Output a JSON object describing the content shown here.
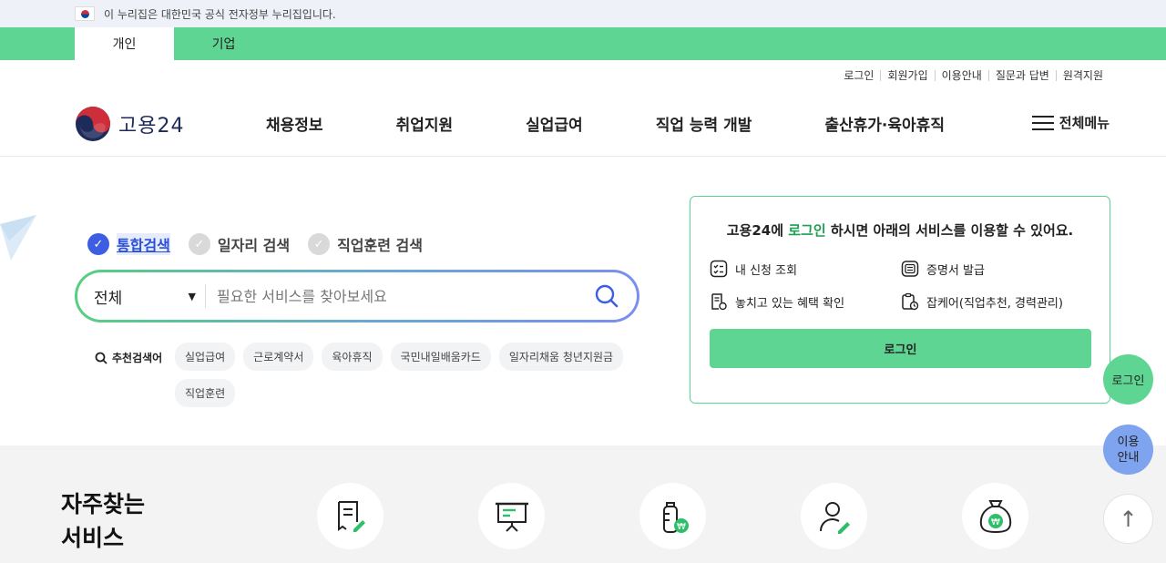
{
  "gov_banner": {
    "text": "이 누리집은 대한민국 공식 전자정부 누리집입니다."
  },
  "audience_tabs": [
    {
      "label": "개인"
    },
    {
      "label": "기업"
    }
  ],
  "util_links": [
    {
      "label": "로그인"
    },
    {
      "label": "회원가입"
    },
    {
      "label": "이용안내"
    },
    {
      "label": "질문과 답변"
    },
    {
      "label": "원격지원"
    }
  ],
  "header": {
    "logo_text": "고용24",
    "menu": [
      {
        "label": "채용정보"
      },
      {
        "label": "취업지원"
      },
      {
        "label": "실업급여"
      },
      {
        "label": "직업 능력 개발"
      },
      {
        "label": "출산휴가·육아휴직"
      }
    ],
    "all_menu": "전체메뉴"
  },
  "search": {
    "tabs": [
      {
        "label": "통합검색"
      },
      {
        "label": "일자리 검색"
      },
      {
        "label": "직업훈련 검색"
      }
    ],
    "scope": "전체",
    "placeholder": "필요한 서비스를 찾아보세요",
    "reco_title": "추천검색어",
    "keywords": [
      "실업급여",
      "근로계약서",
      "육아휴직",
      "국민내일배움카드",
      "일자리채움 청년지원금",
      "직업훈련"
    ]
  },
  "login_card": {
    "title_before": "고용24에 ",
    "title_link": "로그인",
    "title_after": " 하시면 아래의 서비스를 이용할 수 있어요.",
    "items": [
      {
        "label": "내 신청 조회",
        "icon": "checklist-icon"
      },
      {
        "label": "증명서 발급",
        "icon": "certificate-icon"
      },
      {
        "label": "놓치고 있는 혜택 확인",
        "icon": "benefit-doc-icon"
      },
      {
        "label": "잡케어(직업추천, 경력관리)",
        "icon": "jobcare-icon"
      }
    ],
    "button": "로그인"
  },
  "frequent": {
    "title_line1": "자주찾는",
    "title_line2": "서비스",
    "icons": [
      "form-edit-icon",
      "presentation-board-icon",
      "baby-bottle-won-icon",
      "user-edit-icon",
      "money-bag-won-icon"
    ]
  },
  "floating": {
    "login": "로그인",
    "guide_line1": "이용",
    "guide_line2": "안내",
    "top": "↑"
  },
  "colors": {
    "brand_green": "#5ed593",
    "accent_blue": "#3d5ee0",
    "guide_blue": "#7ea4f0"
  }
}
